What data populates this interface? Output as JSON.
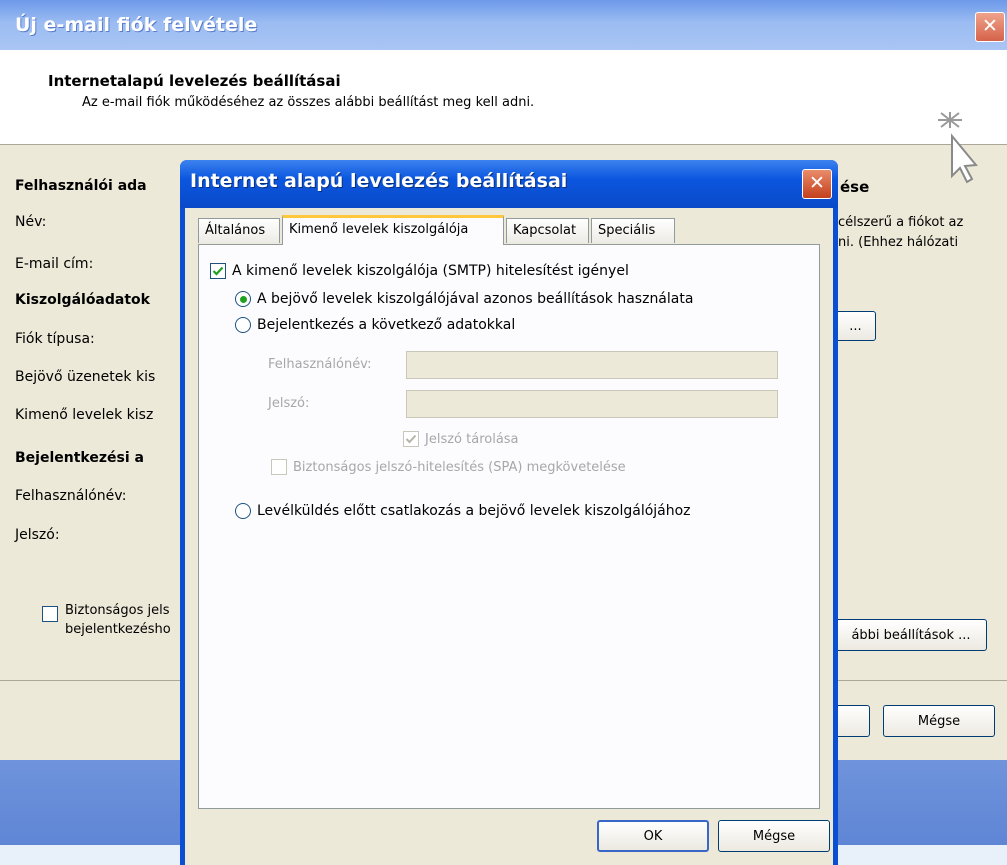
{
  "back_window": {
    "title": "Új e-mail fiók felvétele",
    "header_title": "Internetalapú levelezés beállításai",
    "header_subtitle": "Az e-mail fiók működéséhez az összes alábbi beállítást meg kell adni.",
    "section_user": "Felhasználói ada",
    "label_name": "Név:",
    "label_email": "E-mail cím:",
    "section_server": "Kiszolgálóadatok",
    "label_account_type": "Fiók típusa:",
    "label_incoming": "Bejövő üzenetek kis",
    "label_outgoing": "Kimenő levelek kisz",
    "section_login": "Bejelentkezési a",
    "label_username": "Felhasználónév:",
    "label_password": "Jelszó:",
    "spa_line1": "Biztonságos jels",
    "spa_line2": "bejelentkezésho",
    "right_heading": "ése",
    "right_text_line1": "célszerű a fiókot az",
    "right_text_line2": "ni. (Ehhez hálózati",
    "test_button": "...",
    "more_settings_button": "ábbi beállítások ...",
    "cancel_button": "Mégse"
  },
  "dialog": {
    "title": "Internet alapú levelezés beállításai",
    "tabs": [
      {
        "label": "Általános"
      },
      {
        "label": "Kimenő levelek kiszolgálója"
      },
      {
        "label": "Kapcsolat"
      },
      {
        "label": "Speciális"
      }
    ],
    "smtp_auth_label": "A kimenő levelek kiszolgálója (SMTP) hitelesítést igényel",
    "radio_same_label": "A bejövő levelek kiszolgálójával azonos beállítások használata",
    "radio_login_label": "Bejelentkezés a következő adatokkal",
    "username_label": "Felhasználónév:",
    "password_label": "Jelszó:",
    "remember_password_label": "Jelszó tárolása",
    "spa_label": "Biztonságos jelszó-hitelesítés (SPA) megkövetelése",
    "radio_pop_label": "Levélküldés előtt csatlakozás a bejövő levelek kiszolgálójához",
    "ok_button": "OK",
    "cancel_button": "Mégse"
  }
}
